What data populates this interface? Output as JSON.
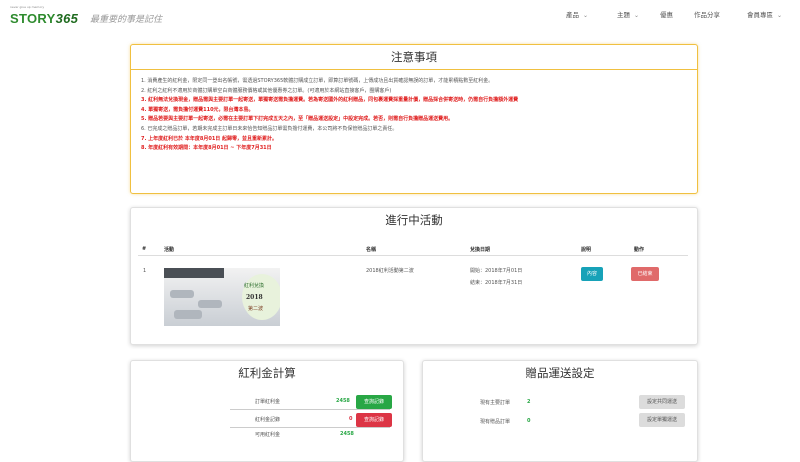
{
  "header": {
    "tagline": "never give up memory",
    "brand": "STORY",
    "brand_num": "365",
    "script": "最重要的事是記住",
    "nav": [
      {
        "label": "產品",
        "chevron": true
      },
      {
        "label": "主題",
        "chevron": true
      },
      {
        "label": "優惠",
        "chevron": false
      },
      {
        "label": "作品分享",
        "chevron": false
      },
      {
        "label": "會員專區",
        "chevron": true
      }
    ]
  },
  "notice": {
    "title": "注意事項",
    "items": [
      {
        "text": "1. 消費產生的紅利金，限定同一登出名帳號，需透過STORY365軟體訂購成立訂單，即算訂單號碼，上傳成功且出貨確認無誤的訂單，才能累積點數至紅利金。",
        "red": false
      },
      {
        "text": "2. 紅利之紅利不適用於商體訂購單空白商體服務價格或其他優惠券之訂單。(可適用於本網站直接客戶，團購客戶)",
        "red": false
      },
      {
        "text": "3. 紅利無法兌換現金，贈品需與主要訂單一起寄送，單獨寄送需負擔運費。若為寄送國外的紅利贈品，同包裹運費採重量計價，贈品採合併寄送時，仍需自行負擔額外運費",
        "red": true
      },
      {
        "text": "4. 單獨寄送，需負擔付運費110元，限台灣本島。",
        "red": true
      },
      {
        "text": "5. 贈品若要與主要訂單一起寄送，必需在主要訂單下訂完成五天之內，至「贈品運送設定」中設定完成。若否，則需自行負擔贈品運送費用。",
        "red": true
      },
      {
        "text": "6. 已完成之贈品訂單，若期未完成主訂單日未來恰告知贈品訂單需負擔付運費，本公司將不負保管贈品訂單之責任。",
        "red": false
      },
      {
        "text": "7. 上年度紅利已於 本年度8月01日 起歸零，並且重新累計。",
        "red": true
      },
      {
        "text": "8. 年度紅利有效期間：本年度8月01日 ~ 下年度7月31日",
        "red": true
      }
    ]
  },
  "activities": {
    "title": "進行中活動",
    "columns": {
      "index": "#",
      "activity": "活動",
      "name": "名稱",
      "period": "兌換日期",
      "desc": "說明",
      "action": "動作"
    },
    "rows": [
      {
        "index": "1",
        "image_text": {
          "line1": "紅利兌換",
          "line2": "2018",
          "line3": "第二波"
        },
        "name": "2018紅利活動第二波",
        "start": "開始：2018年7月01日",
        "end": "結束：2018年7月31日",
        "desc_button": "內容",
        "action_button": "已結束"
      }
    ]
  },
  "bonus": {
    "title": "紅利金計算",
    "rows": [
      {
        "label": "訂單紅利金",
        "value": "2458",
        "value_color": "#28a745",
        "button": "查詢記錄",
        "button_style": "success"
      },
      {
        "label": "紅利金記錄",
        "value": "0",
        "value_color": "#dc3545",
        "button": "查詢記錄",
        "button_style": "red"
      },
      {
        "label": "可用紅利金",
        "value": "2458",
        "value_color": "#28a745"
      }
    ]
  },
  "shipping": {
    "title": "贈品運送設定",
    "rows": [
      {
        "label": "現有主要訂單",
        "value": "2",
        "button": "設定共同運送"
      },
      {
        "label": "現有贈品訂單",
        "value": "0",
        "button": "設定單獨運送"
      }
    ]
  }
}
